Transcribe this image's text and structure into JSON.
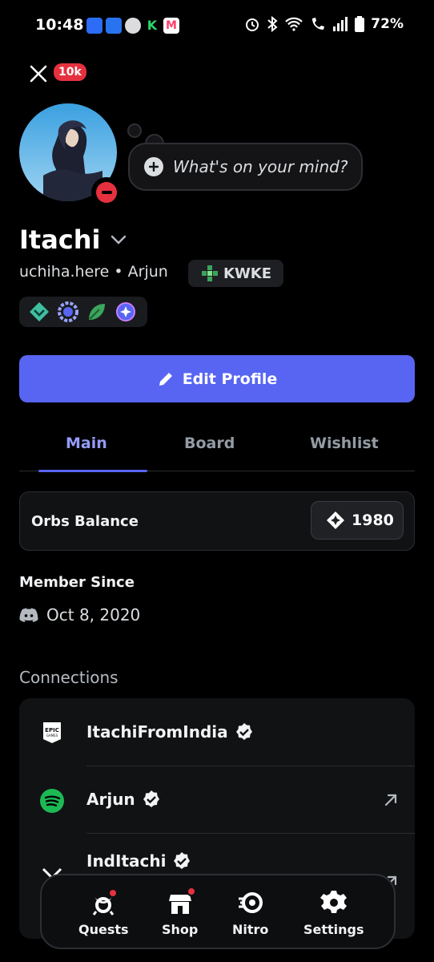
{
  "status_bar": {
    "time": "10:48",
    "battery": "72%",
    "notif_icons": [
      "phone-icon",
      "flipkart-icon",
      "wordpress-icon",
      "kite-icon",
      "myntra-icon"
    ],
    "right_icons": [
      "alarm-icon",
      "bluetooth-icon",
      "wifi-icon",
      "wifi-calling-icon",
      "signal-icon",
      "battery-icon"
    ]
  },
  "header": {
    "notification_count": "10k"
  },
  "profile": {
    "status_placeholder": "What's on your mind?",
    "display_name": "Itachi",
    "username_line": "uchiha.here • Arjun",
    "guild_tag": "KWKE",
    "edit_label": "Edit Profile"
  },
  "tabs": [
    {
      "label": "Main",
      "active": true
    },
    {
      "label": "Board",
      "active": false
    },
    {
      "label": "Wishlist",
      "active": false
    }
  ],
  "orbs": {
    "label": "Orbs Balance",
    "value": "1980"
  },
  "member": {
    "label": "Member Since",
    "date": "Oct 8, 2020"
  },
  "connections": {
    "label": "Connections",
    "items": [
      {
        "service": "epic-games",
        "name": "ItachiFromIndia",
        "verified": true,
        "external": false
      },
      {
        "service": "spotify",
        "name": "Arjun",
        "verified": true,
        "external": true
      },
      {
        "service": "x",
        "name": "IndItachi",
        "verified": true,
        "external": true
      }
    ]
  },
  "nav": [
    {
      "label": "Quests",
      "icon": "quests-icon",
      "dot": true
    },
    {
      "label": "Shop",
      "icon": "shop-icon",
      "dot": true
    },
    {
      "label": "Nitro",
      "icon": "nitro-icon",
      "dot": false
    },
    {
      "label": "Settings",
      "icon": "settings-icon",
      "dot": false
    }
  ],
  "colors": {
    "accent": "#5865f2",
    "accent_text": "#949cf7",
    "danger": "#e5313f",
    "spotify": "#1db954"
  }
}
